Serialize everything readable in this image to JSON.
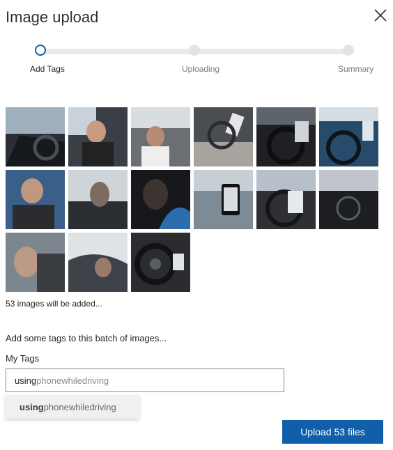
{
  "dialog": {
    "title": "Image upload"
  },
  "stepper": {
    "steps": [
      {
        "label": "Add Tags",
        "state": "active"
      },
      {
        "label": "Uploading",
        "state": "inactive"
      },
      {
        "label": "Summary",
        "state": "inactive"
      }
    ]
  },
  "thumbnails": {
    "count_text": "53 images will be added...",
    "items": [
      "thumb-1",
      "thumb-2",
      "thumb-3",
      "thumb-4",
      "thumb-5",
      "thumb-6",
      "thumb-7",
      "thumb-8",
      "thumb-9",
      "thumb-10",
      "thumb-11",
      "thumb-12",
      "thumb-13",
      "thumb-14",
      "thumb-15"
    ]
  },
  "tags": {
    "prompt": "Add some tags to this batch of images...",
    "label": "My Tags",
    "input_typed": "using",
    "input_rest": "phonewhiledriving",
    "suggestion_match": "using",
    "suggestion_rest": "phonewhiledriving"
  },
  "footer": {
    "upload_label": "Upload 53 files"
  },
  "colors": {
    "accent": "#0f5fab",
    "step_active_border": "#0a5ea8"
  },
  "icons": {
    "close": "close-icon"
  }
}
